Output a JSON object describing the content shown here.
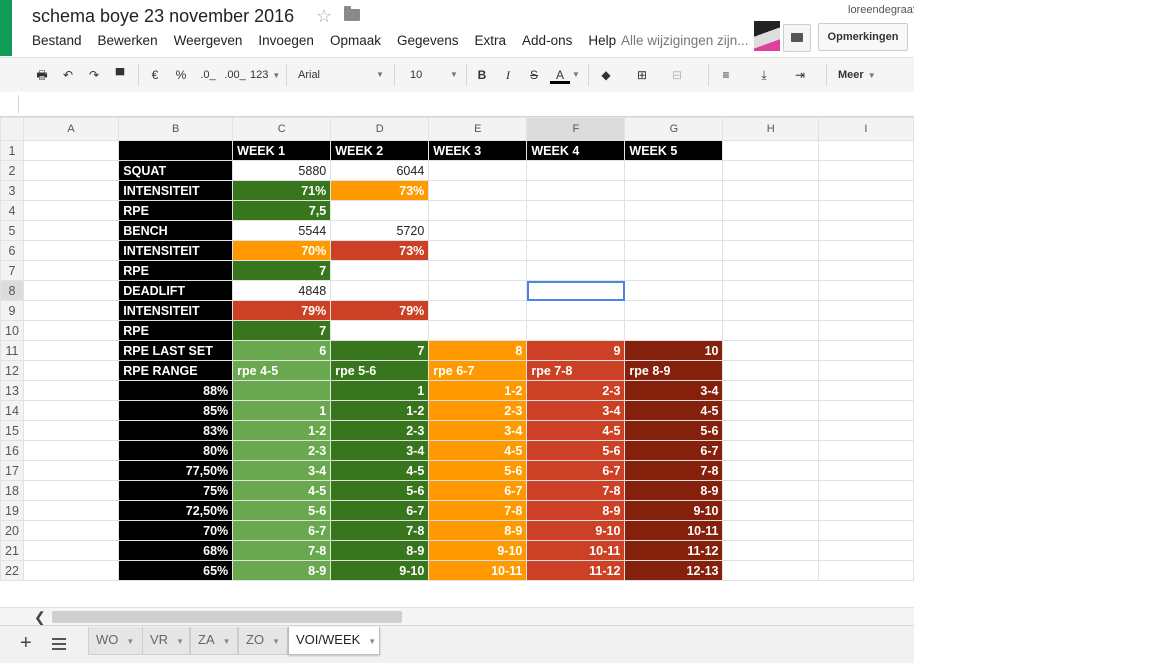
{
  "document": {
    "title": "schema boye 23 november 2016",
    "save_status": "Alle wijzigingen zijn...",
    "user": "loreendegraaf",
    "comments_button": "Opmerkingen"
  },
  "menu": [
    "Bestand",
    "Bewerken",
    "Weergeven",
    "Invoegen",
    "Opmaak",
    "Gegevens",
    "Extra",
    "Add-ons",
    "Help"
  ],
  "toolbar": {
    "currency": "€",
    "percent": "%",
    "decimal_less": ".0_",
    "decimal_more": ".00_",
    "number_format": "123",
    "font_family": "Arial",
    "font_size": "10",
    "bold": "B",
    "italic": "I",
    "strike": "S",
    "text_color": "A",
    "more": "Meer"
  },
  "columns": [
    "A",
    "B",
    "C",
    "D",
    "E",
    "F",
    "G",
    "H",
    "I"
  ],
  "selected_column": "F",
  "grid": {
    "header_row": [
      "WEEK 1",
      "WEEK 2",
      "WEEK 3",
      "WEEK 4",
      "WEEK 5"
    ],
    "rows": [
      {
        "label": "SQUAT",
        "cells": [
          "5880",
          "6044",
          "",
          "",
          ""
        ]
      },
      {
        "label": "INTENSITEIT",
        "cells": [
          "71%",
          "73%",
          "",
          "",
          ""
        ]
      },
      {
        "label": "RPE",
        "cells": [
          "7,5",
          "",
          "",
          "",
          ""
        ]
      },
      {
        "label": "BENCH",
        "cells": [
          "5544",
          "5720",
          "",
          "",
          ""
        ]
      },
      {
        "label": "INTENSITEIT",
        "cells": [
          "70%",
          "73%",
          "",
          "",
          ""
        ]
      },
      {
        "label": "RPE",
        "cells": [
          "7",
          "",
          "",
          "",
          ""
        ]
      },
      {
        "label": "DEADLIFT",
        "cells": [
          "4848",
          "",
          "",
          "",
          ""
        ]
      },
      {
        "label": "INTENSITEIT",
        "cells": [
          "79%",
          "79%",
          "",
          "",
          ""
        ]
      },
      {
        "label": "RPE",
        "cells": [
          "7",
          "",
          "",
          "",
          ""
        ]
      },
      {
        "label": "RPE LAST SET",
        "cells": [
          "6",
          "7",
          "8",
          "9",
          "10"
        ]
      },
      {
        "label": "RPE RANGE",
        "cells": [
          "rpe 4-5",
          "rpe 5-6",
          "rpe 6-7",
          "rpe 7-8",
          "rpe 8-9"
        ]
      },
      {
        "label": "88%",
        "cells": [
          "",
          "1",
          "1-2",
          "2-3",
          "3-4"
        ]
      },
      {
        "label": "85%",
        "cells": [
          "1",
          "1-2",
          "2-3",
          "3-4",
          "4-5"
        ]
      },
      {
        "label": "83%",
        "cells": [
          "1-2",
          "2-3",
          "3-4",
          "4-5",
          "5-6"
        ]
      },
      {
        "label": "80%",
        "cells": [
          "2-3",
          "3-4",
          "4-5",
          "5-6",
          "6-7"
        ]
      },
      {
        "label": "77,50%",
        "cells": [
          "3-4",
          "4-5",
          "5-6",
          "6-7",
          "7-8"
        ]
      },
      {
        "label": "75%",
        "cells": [
          "4-5",
          "5-6",
          "6-7",
          "7-8",
          "8-9"
        ]
      },
      {
        "label": "72,50%",
        "cells": [
          "5-6",
          "6-7",
          "7-8",
          "8-9",
          "9-10"
        ]
      },
      {
        "label": "70%",
        "cells": [
          "6-7",
          "7-8",
          "8-9",
          "9-10",
          "10-11"
        ]
      },
      {
        "label": "68%",
        "cells": [
          "7-8",
          "8-9",
          "9-10",
          "10-11",
          "11-12"
        ]
      },
      {
        "label": "65%",
        "cells": [
          "8-9",
          "9-10",
          "10-11",
          "11-12",
          "12-13"
        ]
      }
    ]
  },
  "colors": {
    "light_green": "#6aa84f",
    "dark_green": "#38761d",
    "orange": "#ff9900",
    "red": "#cc4125",
    "dark_red": "#85200c",
    "black": "#000000"
  },
  "sheets": [
    {
      "name": "WO",
      "active": false
    },
    {
      "name": "VR",
      "active": false
    },
    {
      "name": "ZA",
      "active": false
    },
    {
      "name": "ZO",
      "active": false
    },
    {
      "name": "VOI/WEEK",
      "active": true
    }
  ]
}
